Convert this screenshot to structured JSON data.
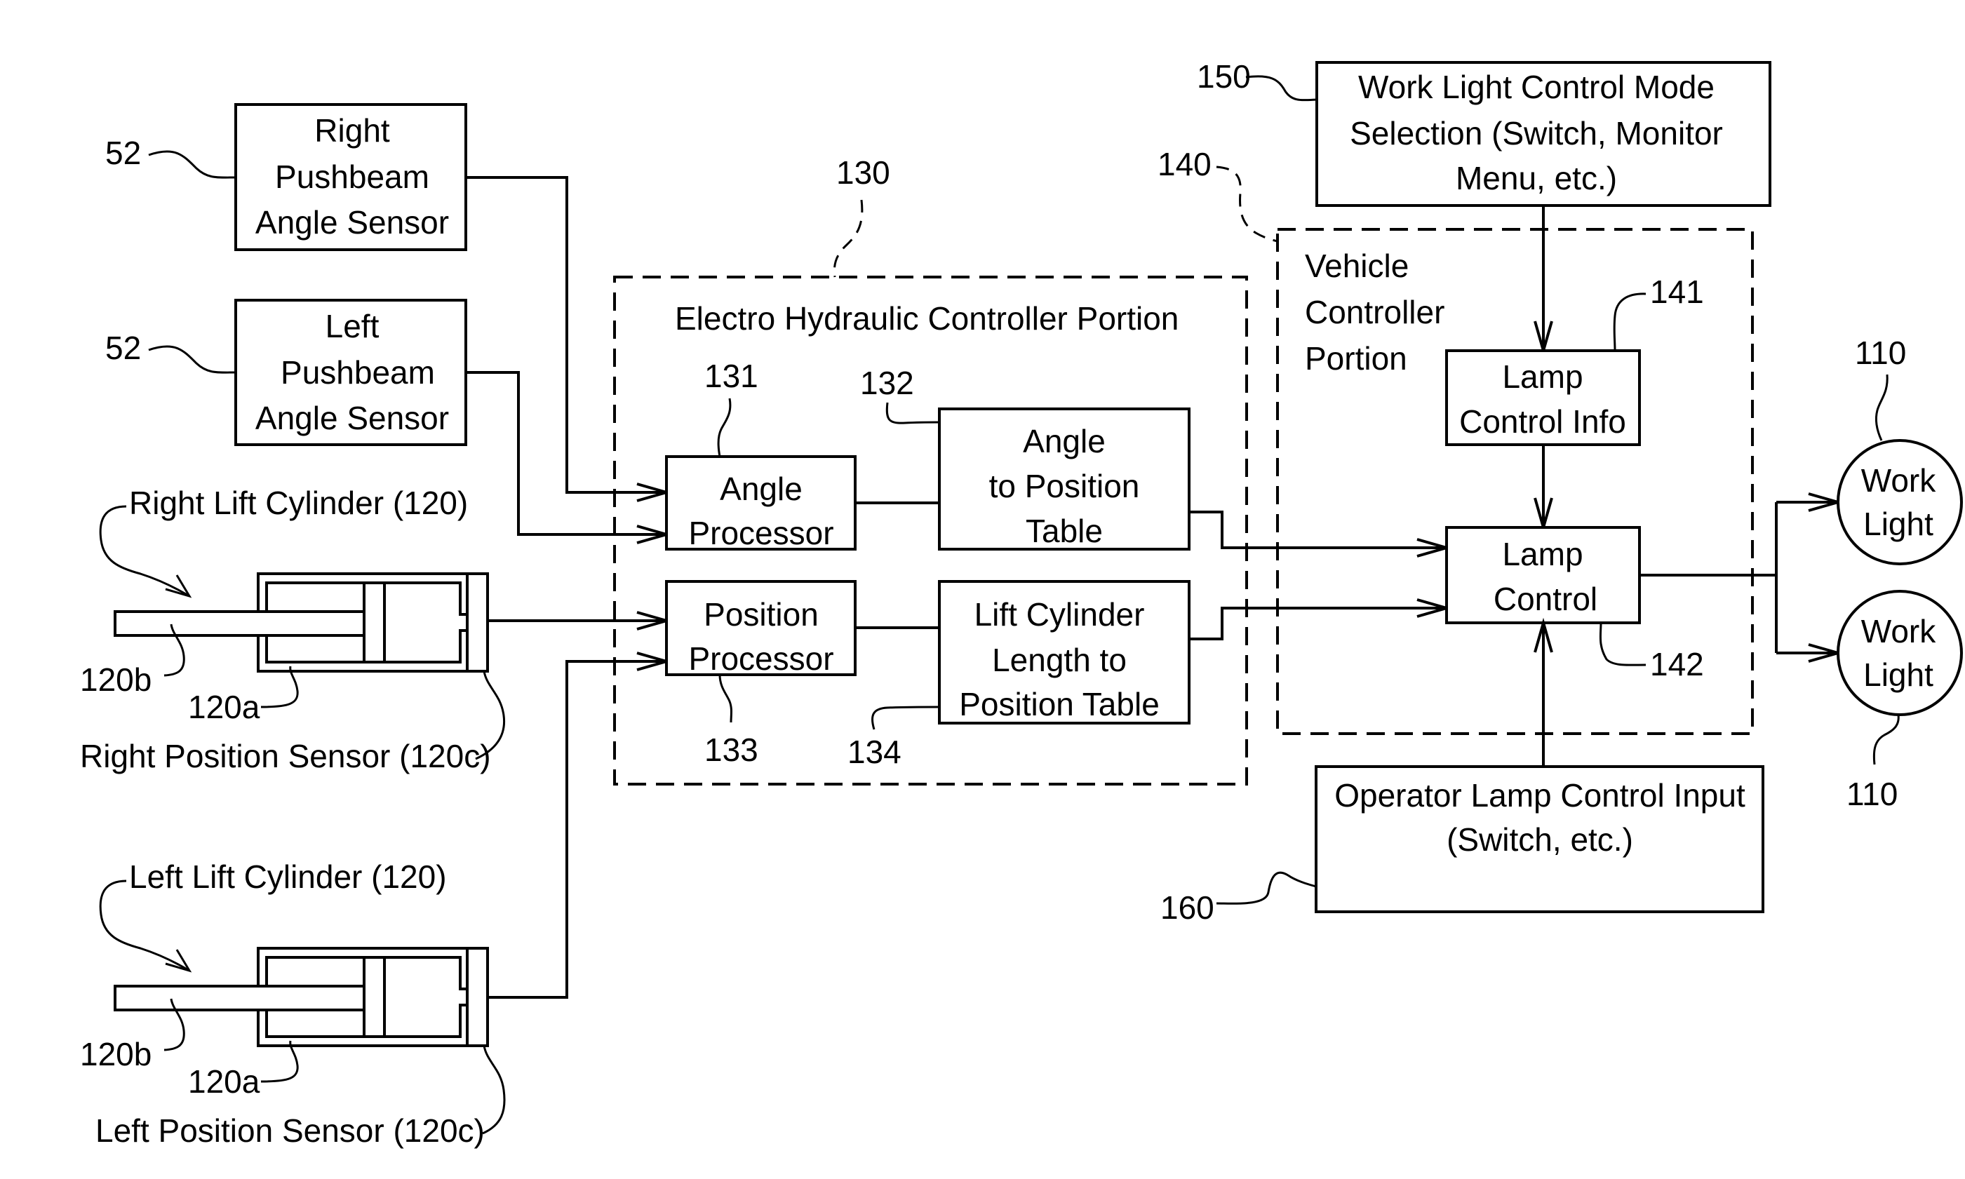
{
  "diagram": {
    "sensors": {
      "right_pushbeam": {
        "lines": [
          "Right",
          "Pushbeam",
          "Angle Sensor"
        ],
        "ref": "52"
      },
      "left_pushbeam": {
        "lines": [
          "Left",
          "Pushbeam",
          "Angle Sensor"
        ],
        "ref": "52"
      }
    },
    "cylinders": {
      "right": {
        "title": "Right Lift Cylinder (120)",
        "rod_ref": "120b",
        "body_ref": "120a",
        "sensor_label": "Right Position Sensor (120c)"
      },
      "left": {
        "title": "Left Lift Cylinder (120)",
        "rod_ref": "120b",
        "body_ref": "120a",
        "sensor_label": "Left Position Sensor (120c)"
      }
    },
    "eh_controller": {
      "ref": "130",
      "title": "Electro Hydraulic Controller Portion",
      "angle_processor": {
        "lines": [
          "Angle",
          "Processor"
        ],
        "ref": "131"
      },
      "angle_table": {
        "lines": [
          "Angle",
          "to Position",
          "Table"
        ],
        "ref": "132"
      },
      "position_processor": {
        "lines": [
          "Position",
          "Processor"
        ],
        "ref": "133"
      },
      "length_table": {
        "lines": [
          "Lift Cylinder",
          "Length to",
          "Position Table"
        ],
        "ref": "134"
      }
    },
    "vehicle_controller": {
      "ref": "140",
      "title_lines": [
        "Vehicle",
        "Controller",
        "Portion"
      ],
      "lamp_control_info": {
        "lines": [
          "Lamp",
          "Control Info"
        ],
        "ref": "141"
      },
      "lamp_control": {
        "lines": [
          "Lamp",
          "Control"
        ],
        "ref": "142"
      }
    },
    "mode_selection": {
      "ref": "150",
      "lines": [
        "Work Light Control Mode",
        "Selection (Switch, Monitor",
        "Menu, etc.)"
      ]
    },
    "operator_input": {
      "ref": "160",
      "lines": [
        "Operator Lamp Control Input",
        "(Switch, etc.)"
      ]
    },
    "work_lights": [
      {
        "lines": [
          "Work",
          "Light"
        ],
        "ref": "110"
      },
      {
        "lines": [
          "Work",
          "Light"
        ],
        "ref": "110"
      }
    ]
  }
}
